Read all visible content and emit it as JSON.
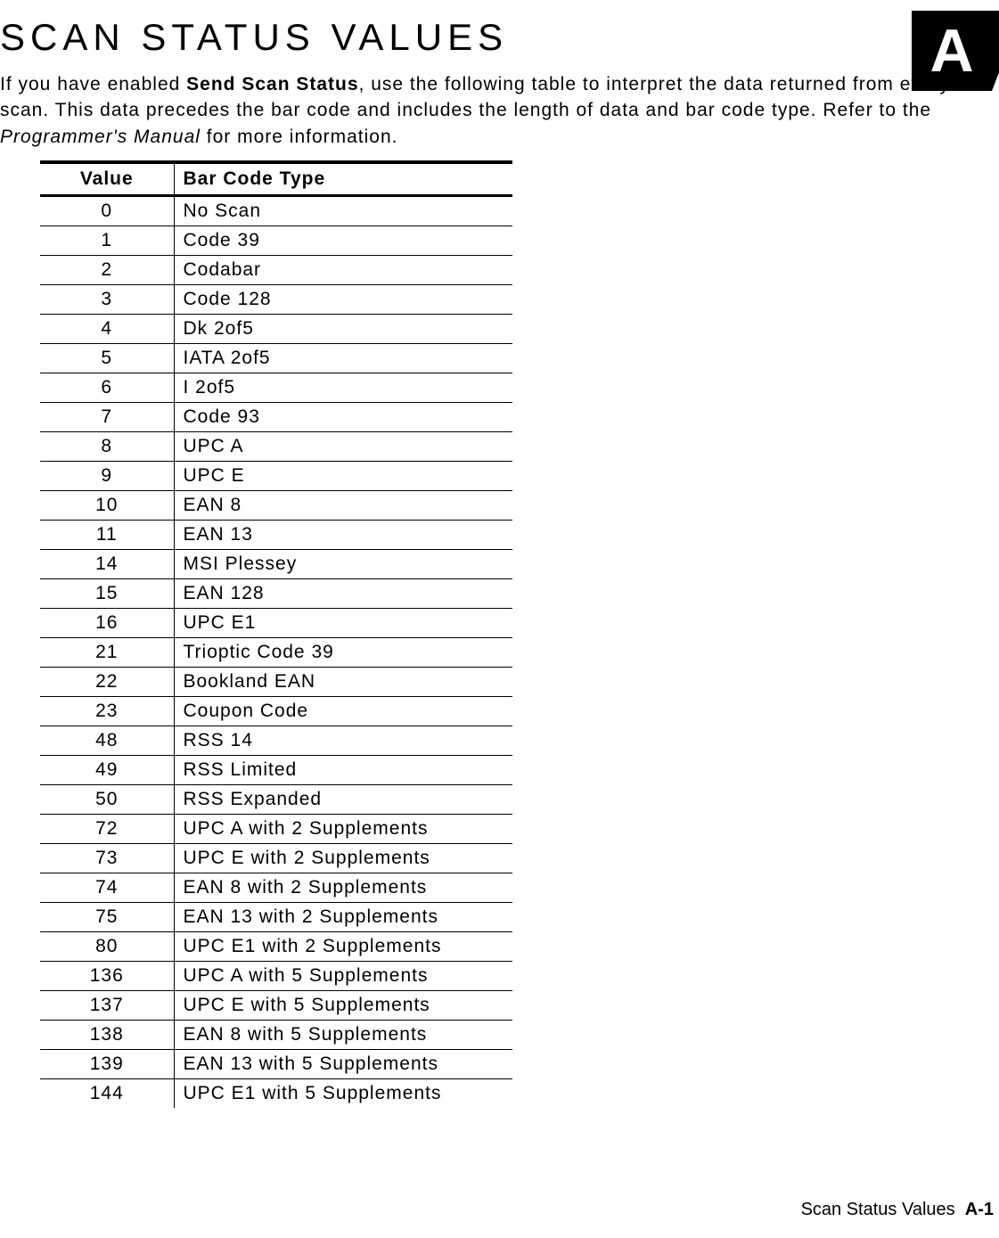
{
  "title": "SCAN STATUS VALUES",
  "appendix_letter": "A",
  "intro": {
    "pre": "If you have enabled ",
    "bold1": "Send Scan Status",
    "mid1": ", use the following table to interpret the data returned from every scan.  This data precedes the bar code and includes the length of data and bar code type.  Refer to the ",
    "italic1": "Programmer's Manual",
    "post": " for more information."
  },
  "table": {
    "headers": {
      "value": "Value",
      "type": "Bar Code Type"
    },
    "rows": [
      {
        "value": "0",
        "type": "No Scan"
      },
      {
        "value": "1",
        "type": "Code 39"
      },
      {
        "value": "2",
        "type": "Codabar"
      },
      {
        "value": "3",
        "type": "Code 128"
      },
      {
        "value": "4",
        "type": "Dk 2of5"
      },
      {
        "value": "5",
        "type": "IATA 2of5"
      },
      {
        "value": "6",
        "type": "I 2of5"
      },
      {
        "value": "7",
        "type": "Code 93"
      },
      {
        "value": "8",
        "type": "UPC A"
      },
      {
        "value": "9",
        "type": "UPC E"
      },
      {
        "value": "10",
        "type": "EAN 8"
      },
      {
        "value": "11",
        "type": "EAN 13"
      },
      {
        "value": "14",
        "type": "MSI Plessey"
      },
      {
        "value": "15",
        "type": "EAN 128"
      },
      {
        "value": "16",
        "type": "UPC E1"
      },
      {
        "value": "21",
        "type": "Trioptic Code 39"
      },
      {
        "value": "22",
        "type": "Bookland EAN"
      },
      {
        "value": "23",
        "type": "Coupon Code"
      },
      {
        "value": "48",
        "type": "RSS 14"
      },
      {
        "value": "49",
        "type": "RSS Limited"
      },
      {
        "value": "50",
        "type": "RSS Expanded"
      },
      {
        "value": "72",
        "type": "UPC A with 2 Supplements"
      },
      {
        "value": "73",
        "type": "UPC E with 2 Supplements"
      },
      {
        "value": "74",
        "type": "EAN 8 with 2 Supplements"
      },
      {
        "value": "75",
        "type": "EAN 13 with 2 Supplements"
      },
      {
        "value": "80",
        "type": "UPC E1 with 2 Supplements"
      },
      {
        "value": "136",
        "type": "UPC A with 5 Supplements"
      },
      {
        "value": "137",
        "type": "UPC E with 5 Supplements"
      },
      {
        "value": "138",
        "type": "EAN 8 with 5 Supplements"
      },
      {
        "value": "139",
        "type": "EAN 13 with 5 Supplements"
      },
      {
        "value": "144",
        "type": "UPC E1 with 5 Supplements"
      }
    ]
  },
  "footer": {
    "label": "Scan Status Values",
    "page": "A-1"
  }
}
